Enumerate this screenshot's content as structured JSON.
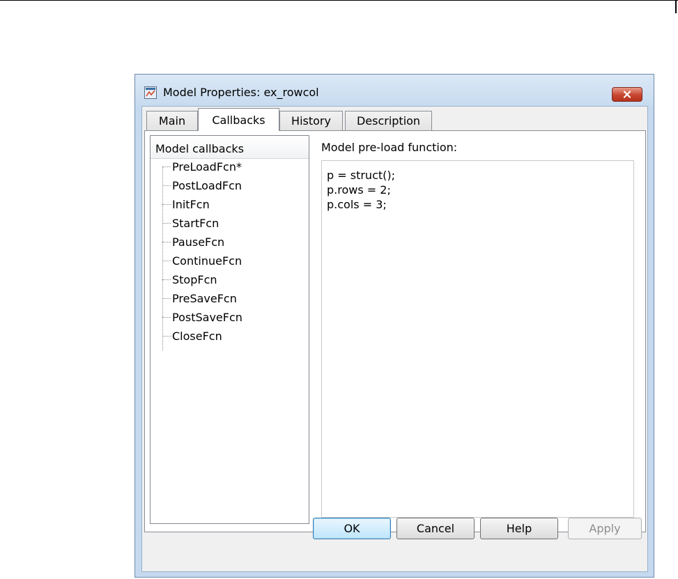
{
  "dialog": {
    "title": "Model Properties: ex_rowcol",
    "app_icon": "simulink-model-icon",
    "close_icon": "close-icon"
  },
  "tabs": [
    {
      "label": "Main",
      "active": false
    },
    {
      "label": "Callbacks",
      "active": true
    },
    {
      "label": "History",
      "active": false
    },
    {
      "label": "Description",
      "active": false
    }
  ],
  "callbacks_tree": {
    "header": "Model callbacks",
    "items": [
      {
        "label": "PreLoadFcn*",
        "selected": true
      },
      {
        "label": "PostLoadFcn"
      },
      {
        "label": "InitFcn"
      },
      {
        "label": "StartFcn"
      },
      {
        "label": "PauseFcn"
      },
      {
        "label": "ContinueFcn"
      },
      {
        "label": "StopFcn"
      },
      {
        "label": "PreSaveFcn"
      },
      {
        "label": "PostSaveFcn"
      },
      {
        "label": "CloseFcn"
      }
    ]
  },
  "editor": {
    "label": "Model pre-load function:",
    "lines": [
      "p = struct();",
      "p.rows = 2;",
      "p.cols = 3;"
    ]
  },
  "buttons": {
    "ok": "OK",
    "cancel": "Cancel",
    "help": "Help",
    "apply": "Apply",
    "apply_enabled": false
  },
  "colors": {
    "title_bar": "#c5d9ef",
    "close_button": "#c8452f",
    "default_button_border": "#3c7fb1"
  }
}
